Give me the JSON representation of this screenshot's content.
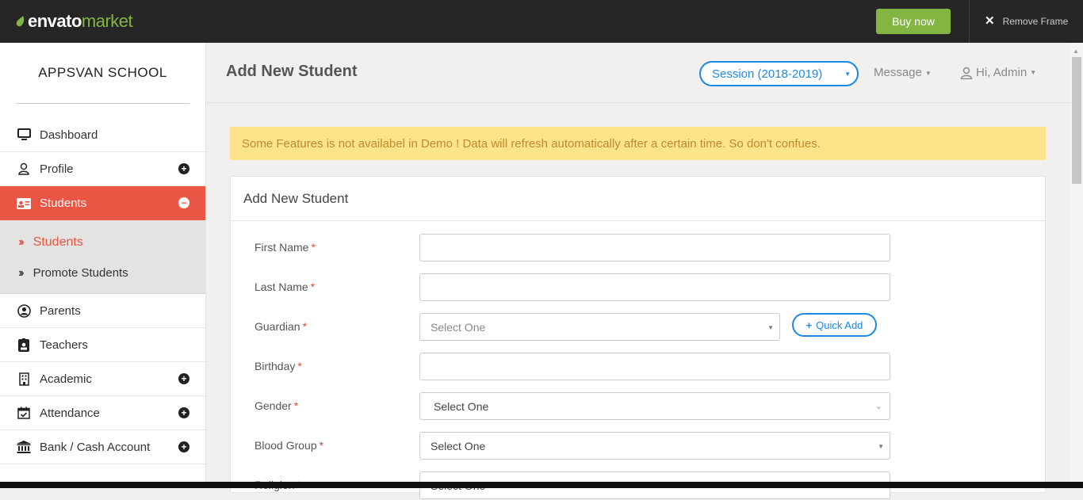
{
  "topbar": {
    "logo_envato": "envato",
    "logo_market": "market",
    "buy_label": "Buy now",
    "remove_frame_label": "Remove Frame",
    "accent": "#82b541"
  },
  "sidebar": {
    "school_name": "APPSVAN SCHOOL",
    "items": [
      {
        "label": "Dashboard",
        "icon": "monitor-icon"
      },
      {
        "label": "Profile",
        "icon": "user-icon",
        "expand": "+"
      },
      {
        "label": "Students",
        "icon": "id-card-icon",
        "expand": "−",
        "active": true
      },
      {
        "label": "Parents",
        "icon": "user-circle-icon"
      },
      {
        "label": "Teachers",
        "icon": "teacher-badge-icon"
      },
      {
        "label": "Academic",
        "icon": "building-icon",
        "expand": "+"
      },
      {
        "label": "Attendance",
        "icon": "calendar-check-icon",
        "expand": "+"
      },
      {
        "label": "Bank / Cash Account",
        "icon": "bank-icon",
        "expand": "+"
      }
    ],
    "sub_items": [
      {
        "label": "Students",
        "active": true
      },
      {
        "label": "Promote Students"
      }
    ],
    "active_color": "#ea5544"
  },
  "header": {
    "page_title": "Add New Student",
    "session_label": "Session (2018-2019)",
    "message_label": "Message",
    "user_label": "Hi, Admin"
  },
  "alert": {
    "text": "Some Features is not availabel in Demo ! Data will refresh automatically after a certain time. So don't confues."
  },
  "form": {
    "title": "Add New Student",
    "required_mark": "*",
    "fields": [
      {
        "label": "First Name",
        "type": "text",
        "value": ""
      },
      {
        "label": "Last Name",
        "type": "text",
        "value": ""
      },
      {
        "label": "Guardian",
        "type": "select",
        "value": "Select One"
      },
      {
        "label": "Birthday",
        "type": "text",
        "value": ""
      },
      {
        "label": "Gender",
        "type": "select",
        "value": "Select One"
      },
      {
        "label": "Blood Group",
        "type": "select",
        "value": "Select One"
      },
      {
        "label": "Religion",
        "type": "select",
        "value": "Select One"
      }
    ],
    "quick_add_label": "Quick Add"
  }
}
